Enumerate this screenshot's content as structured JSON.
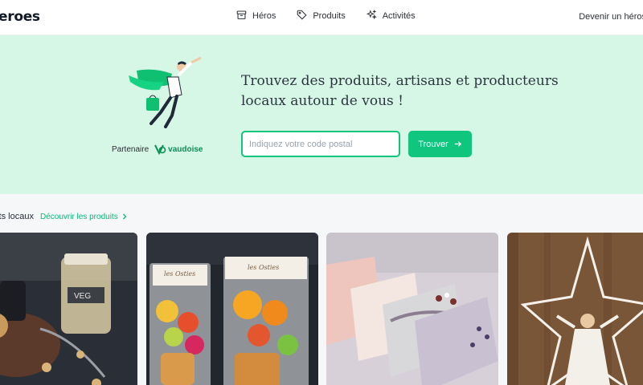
{
  "header": {
    "logo_text": "eroes",
    "nav": [
      {
        "label": "Héros",
        "icon": "archive-box-icon"
      },
      {
        "label": "Produits",
        "icon": "tag-icon"
      },
      {
        "label": "Activités",
        "icon": "sparkles-icon"
      }
    ],
    "become_label": "Devenir un héros"
  },
  "hero": {
    "title": "Trouvez des produits, artisans et producteurs locaux autour de vous !",
    "partner_label": "Partenaire",
    "partner_name": "vaudoise",
    "zip_placeholder": "Indiquez votre code postal",
    "find_button_label": "Trouver"
  },
  "section": {
    "title": "uits locaux",
    "link_label": "Découvrir les produits"
  },
  "cards": [
    {
      "name": "product-card-jars",
      "label": "VEG"
    },
    {
      "name": "product-card-bags",
      "bag_label_1": "les Osties",
      "bag_label_2": "les Osties"
    },
    {
      "name": "product-card-soaps"
    },
    {
      "name": "product-card-star"
    }
  ],
  "colors": {
    "accent": "#10c67f",
    "hero_bg": "#d6f6e6",
    "link": "#10b674"
  }
}
